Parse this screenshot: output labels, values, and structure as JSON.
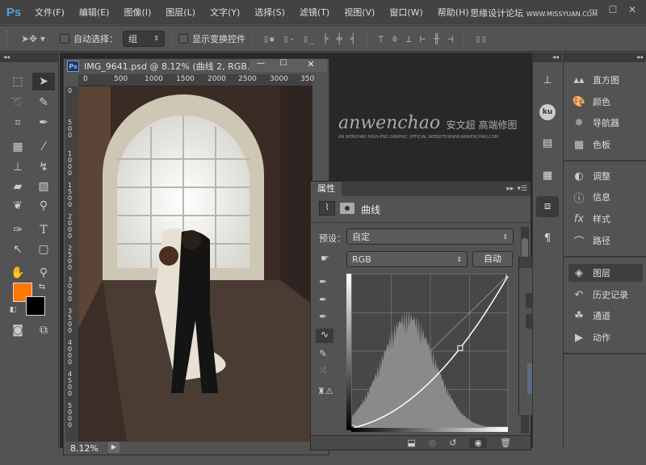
{
  "app": {
    "logo": "Ps"
  },
  "menu": [
    "文件(F)",
    "编辑(E)",
    "图像(I)",
    "图层(L)",
    "文字(Y)",
    "选择(S)",
    "滤镜(T)",
    "视图(V)",
    "窗口(W)",
    "帮助(H)"
  ],
  "watermark": {
    "text": "思缘设计论坛",
    "url": "WWW.MISSYUAN.COM"
  },
  "window_controls": {
    "minimize": "—",
    "maximize": "☐",
    "close": "✕"
  },
  "options_bar": {
    "auto_select_label": "自动选择：",
    "auto_select_checked": false,
    "auto_select_value": "组",
    "show_transform_label": "显示变换控件",
    "show_transform_checked": false
  },
  "toolbox": {
    "collapse": "◂◂",
    "foreground_color": "#ff7700",
    "background_color": "#000000"
  },
  "document": {
    "title": "IMG_9641.psd @ 8.12% (曲线 2, RGB...",
    "zoom": "8.12%",
    "ruler_top": [
      "0",
      "500",
      "1000",
      "1500",
      "2000",
      "2500",
      "3000",
      "350"
    ],
    "ruler_left": [
      "0",
      "500",
      "1000",
      "1500",
      "2000",
      "2500",
      "3000",
      "3500",
      "4000",
      "4500",
      "5000"
    ]
  },
  "brand_overlay": {
    "script": "anwenchao",
    "cn": "安文超 高端修图",
    "tagline": "AN WENCHAO HIGH-END GRAPHIC OFFICIAL WEBSITE/WWW.ANWENCHAO.COM"
  },
  "properties_panel": {
    "tab": "属性",
    "adjustment": "曲线",
    "preset_label": "预设：",
    "preset_value": "自定",
    "channel_value": "RGB",
    "auto_button": "自动",
    "curve_points": [
      [
        0,
        0
      ],
      [
        0.69,
        0.52
      ],
      [
        1,
        1
      ]
    ]
  },
  "right_panels": {
    "group1": [
      "直方图",
      "颜色",
      "导航器",
      "色板"
    ],
    "group2": [
      "调整",
      "信息",
      "样式",
      "路径"
    ],
    "group3": [
      "图层",
      "历史记录",
      "通道",
      "动作"
    ],
    "active": "图层"
  }
}
